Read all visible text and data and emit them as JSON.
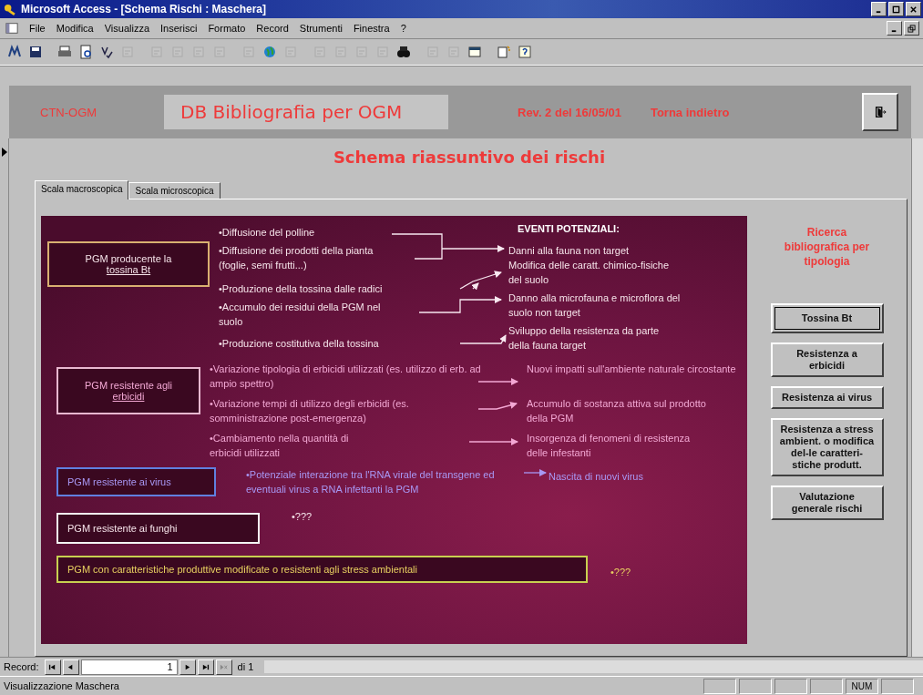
{
  "window": {
    "title": "Microsoft Access - [Schema Rischi : Maschera]"
  },
  "menu": [
    "File",
    "Modifica",
    "Visualizza",
    "Inserisci",
    "Formato",
    "Record",
    "Strumenti",
    "Finestra",
    "?"
  ],
  "header": {
    "org": "CTN-OGM",
    "db_title": "DB Bibliografia per OGM",
    "revision": "Rev. 2 del 16/05/01",
    "back_label": "Torna indietro"
  },
  "form_title": "Schema riassuntivo dei rischi",
  "tabs": [
    {
      "label": "Scala macroscopica",
      "selected": true
    },
    {
      "label": "Scala microscopica",
      "selected": false
    }
  ],
  "diagram": {
    "heading": "EVENTI POTENZIALI:",
    "categories": [
      {
        "label": "PGM producente la",
        "link": "tossina Bt",
        "color": "#d8b070",
        "causes": [
          "•Diffusione del polline",
          "•Diffusione dei prodotti della pianta (foglie, semi frutti...)",
          "•Produzione della tossina dalle radici",
          "•Accumulo dei residui della PGM nel suolo",
          "•Produzione costitutiva della tossina"
        ],
        "effects": [
          "Danni alla fauna non target",
          "Modifica delle caratt. chimico-fisiche del suolo",
          "Danno alla microfauna e microflora del suolo non target",
          "Sviluppo della resistenza da parte della fauna target"
        ]
      },
      {
        "label": "PGM resistente agli",
        "link": "erbicidi",
        "color": "#e8b8d0",
        "causes": [
          "•Variazione tipologia di erbicidi utilizzati (es. utilizzo di erb. ad ampio spettro)",
          "•Variazione tempi di utilizzo degli erbicidi (es. somministrazione post-emergenza)",
          "•Cambiamento nella quantità di erbicidi utilizzati"
        ],
        "effects": [
          "Nuovi impatti sull'ambiente naturale circostante",
          "Accumulo di sostanza attiva sul prodotto della PGM",
          "Insorgenza di fenomeni di resistenza delle infestanti"
        ]
      },
      {
        "label": "PGM resistente ai virus",
        "color": "#6080e0",
        "causes": [
          "•Potenziale interazione tra l'RNA virale del transgene ed eventuali virus a RNA infettanti la PGM"
        ],
        "effects": [
          "Nascita di nuovi virus"
        ]
      },
      {
        "label": "PGM resistente ai funghi",
        "color": "#f4f4f4",
        "causes": [
          "•???"
        ]
      },
      {
        "label": "PGM con caratteristiche produttive modificate o resistenti agli stress ambientali",
        "color": "#c8d050",
        "causes": [
          "•???"
        ]
      }
    ]
  },
  "search": {
    "heading": "Ricerca bibliografica per tipologia",
    "buttons": [
      {
        "label": "Tossina Bt",
        "focused": true
      },
      {
        "label": "Resistenza a erbicidi",
        "focused": false
      },
      {
        "label": "Resistenza ai virus",
        "focused": false
      },
      {
        "label": "Resistenza a stress ambient. o modifica del-le caratteri-stiche produtt.",
        "focused": false
      },
      {
        "label": "Valutazione generale rischi",
        "focused": false
      }
    ]
  },
  "record_nav": {
    "label": "Record:",
    "current": "1",
    "total": "di 1"
  },
  "status_bar": {
    "text": "Visualizzazione Maschera",
    "indicator": "NUM"
  }
}
